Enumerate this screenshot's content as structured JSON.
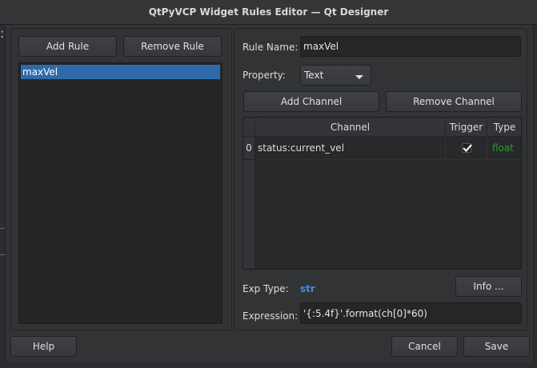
{
  "window": {
    "title": "QtPyVCP Widget Rules Editor — Qt Designer"
  },
  "rules_panel": {
    "add_label": "Add Rule",
    "remove_label": "Remove Rule",
    "rules": [
      "maxVel"
    ]
  },
  "rule_panel": {
    "name_label": "Rule Name:",
    "name_value": "maxVel",
    "property_label": "Property:",
    "property_value": "Text",
    "add_channel_label": "Add Channel",
    "remove_channel_label": "Remove Channel",
    "table": {
      "headers": [
        "Channel",
        "Trigger",
        "Type"
      ],
      "rows": [
        {
          "index": "0",
          "channel": "status:current_vel",
          "trigger": true,
          "type": "float"
        }
      ]
    },
    "exp_type_label": "Exp Type:",
    "exp_type_value": "str",
    "info_label": "Info ...",
    "expression_label": "Expression:",
    "expression_value": "'{:5.4f}'.format(ch[0]*60)"
  },
  "footer": {
    "help_label": "Help",
    "cancel_label": "Cancel",
    "save_label": "Save"
  },
  "colors": {
    "selection": "#2f6aa8",
    "type_text": "#2f9a2f",
    "exp_type_text": "#3d8fe6"
  }
}
